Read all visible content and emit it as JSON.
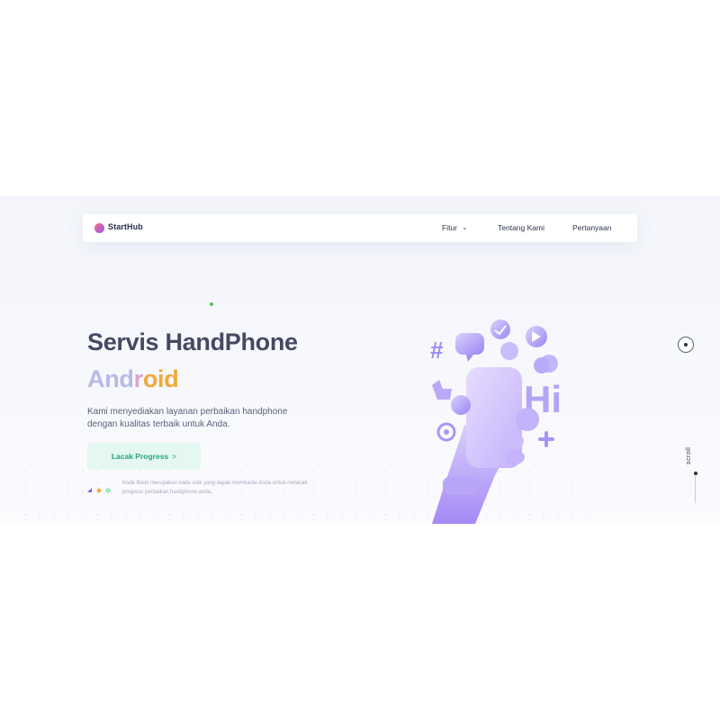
{
  "brand": {
    "name": "StartHub"
  },
  "nav": {
    "items": [
      {
        "label": "Fitur",
        "has_dropdown": true
      },
      {
        "label": "Tentang Kami"
      },
      {
        "label": "Pertanyaan"
      }
    ]
  },
  "hero": {
    "title_line1": "Servis HandPhone",
    "title_line2": {
      "part1": "And",
      "part2": "r",
      "part3": "oid"
    },
    "description": "Kami menyediakan layanan perbaikan handphone dengan kualitas terbaik untuk Anda.",
    "cta_label": "Lacak Progress",
    "note": "Kode Book merupakan kode unik yang dapat membantu Anda untuk melacak progress perbaikan handphone anda."
  },
  "side": {
    "scroll_label": "scroll"
  },
  "colors": {
    "accent_orange": "#f0a93b",
    "accent_purple": "#b7b9e6",
    "cta_bg": "#e5f7f1",
    "cta_text": "#1fa77a",
    "title": "#454a63"
  }
}
